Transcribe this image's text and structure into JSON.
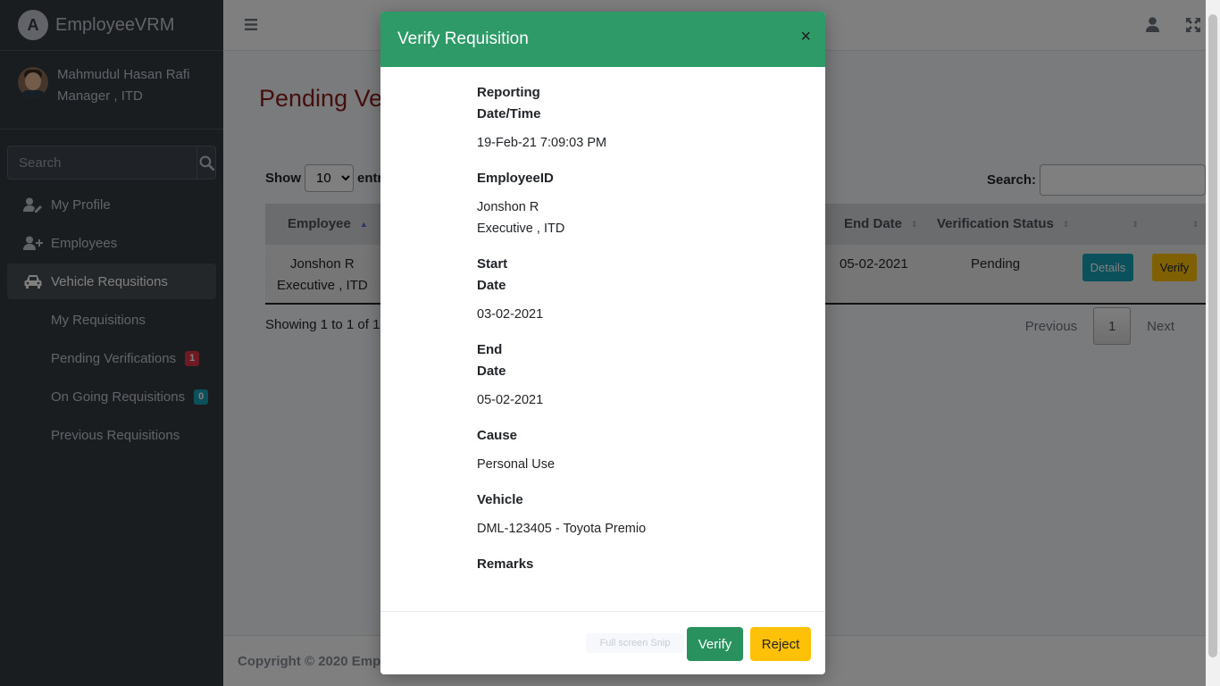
{
  "brand": {
    "name": "EmployeeVRM",
    "logo_letter": "A"
  },
  "user": {
    "name": "Mahmudul Hasan Rafi",
    "role": "Manager , ITD"
  },
  "sidebar_search": {
    "placeholder": "Search"
  },
  "nav": {
    "my_profile": "My Profile",
    "employees": "Employees",
    "vehicle_requisitions": "Vehicle Requsitions",
    "my_requisitions": "My Requisitions",
    "pending_verifications": "Pending Verifications",
    "pending_count": "1",
    "ongoing_requisitions": "On Going Requisitions",
    "ongoing_count": "0",
    "previous_requisitions": "Previous Requisitions"
  },
  "page": {
    "title": "Pending Ver"
  },
  "table_controls": {
    "show_label": "Show",
    "show_value": "10",
    "entries_label": "entr",
    "search_label": "Search:",
    "showing_text": "Showing 1 to 1 of 1",
    "previous": "Previous",
    "page_number": "1",
    "next": "Next"
  },
  "table": {
    "headers": {
      "employee": "Employee",
      "end_date": "End Date",
      "verification_status": "Verification Status"
    },
    "row": {
      "employee_name": "Jonshon R",
      "employee_role": "Executive , ITD",
      "end_date": "05-02-2021",
      "status": "Pending",
      "details_label": "Details",
      "verify_label": "Verify"
    }
  },
  "footer": {
    "text": "Copyright © 2020 Empl"
  },
  "modal": {
    "title": "Verify Requisition",
    "close": "×",
    "fields": {
      "reporting_label_1": "Reporting",
      "reporting_label_2": "Date/Time",
      "reporting_value": "19-Feb-21 7:09:03 PM",
      "employee_id_label": "EmployeeID",
      "employee_name": "Jonshon R",
      "employee_role": "Executive , ITD",
      "start_label_1": "Start",
      "start_label_2": "Date",
      "start_value": "03-02-2021",
      "end_label_1": "End",
      "end_label_2": "Date",
      "end_value": "05-02-2021",
      "cause_label": "Cause",
      "cause_value": "Personal Use",
      "vehicle_label": "Vehicle",
      "vehicle_value": "DML-123405 - Toyota Premio",
      "remarks_label": "Remarks"
    },
    "ghost_hint": "Full screen Snip",
    "verify_button": "Verify",
    "reject_button": "Reject"
  },
  "colors": {
    "modal_header": "#2e9a68",
    "verify_green": "#28915e",
    "reject_yellow": "#ffc107",
    "sidebar_bg": "#343a40",
    "title_red": "#8b1a1a"
  }
}
